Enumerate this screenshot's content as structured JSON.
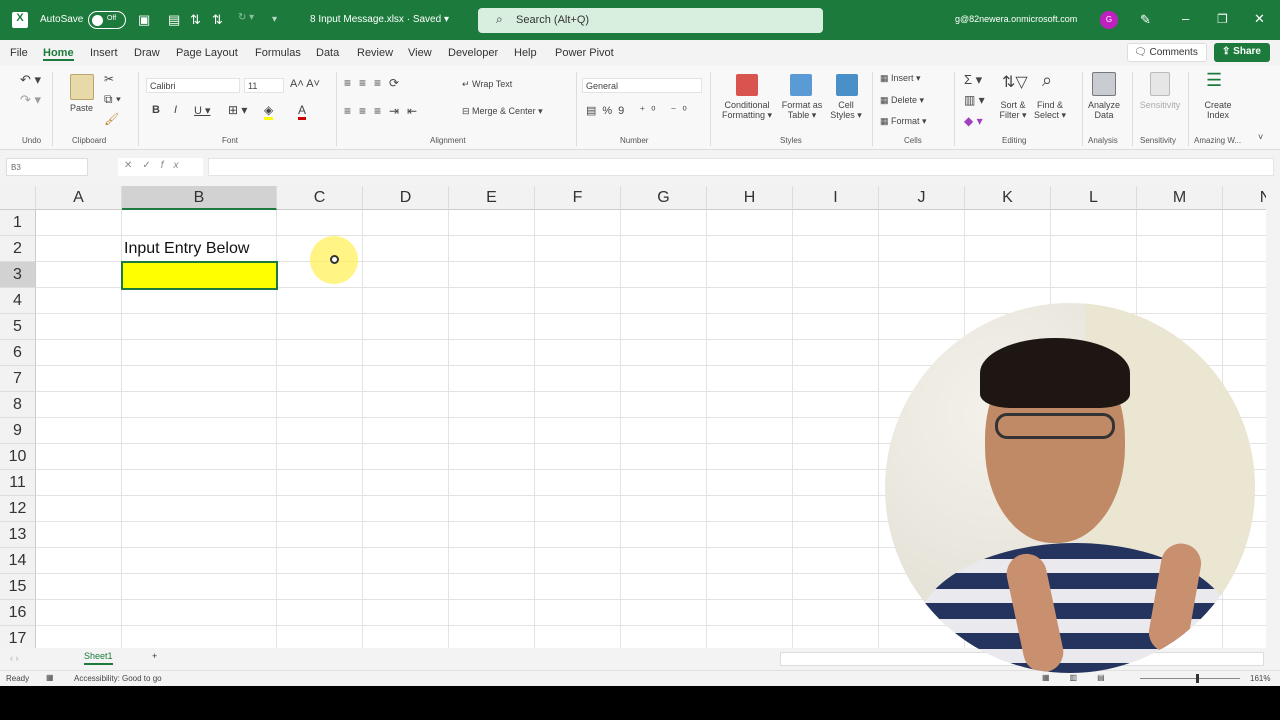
{
  "titlebar": {
    "autosave": "AutoSave",
    "toggle": "Off",
    "filename": "8 Input Message.xlsx · Saved ▾",
    "search": "Search (Alt+Q)",
    "account": "g@82newera.onmicrosoft.com",
    "avatar": "G"
  },
  "menu": [
    "File",
    "Home",
    "Insert",
    "Draw",
    "Page Layout",
    "Formulas",
    "Data",
    "Review",
    "View",
    "Developer",
    "Help",
    "Power Pivot"
  ],
  "comments": "Comments",
  "share": "Share",
  "ribbon": {
    "font_name": "Calibri",
    "font_size": "11",
    "wrap_text": "Wrap Text",
    "merge": "Merge & Center",
    "number_format": "General",
    "paste": "Paste",
    "cond_fmt": "Conditional Formatting ▾",
    "fmt_table": "Format as Table ▾",
    "cell_styles": "Cell Styles ▾",
    "insert": "Insert",
    "delete": "Delete",
    "format": "Format",
    "sort": "Sort & Filter ▾",
    "find": "Find & Select ▾",
    "analyze": "Analyze Data",
    "sensitivity": "Sensitivity",
    "create_index": "Create Index",
    "groups": [
      "Undo",
      "Clipboard",
      "Font",
      "Alignment",
      "Number",
      "Styles",
      "Cells",
      "Editing",
      "Analysis",
      "Sensitivity",
      "Amazing W..."
    ]
  },
  "namebox": "B3",
  "fx": "fx",
  "columns": [
    "A",
    "B",
    "C",
    "D",
    "E",
    "F",
    "G",
    "H",
    "I",
    "J",
    "K",
    "L",
    "M",
    "N"
  ],
  "rows": [
    "1",
    "2",
    "3",
    "4",
    "5",
    "6",
    "7",
    "8",
    "9",
    "10",
    "11",
    "12",
    "13",
    "14",
    "15",
    "16",
    "17"
  ],
  "cells": {
    "B2": "Input Entry Below"
  },
  "highlight_color": "#ffff00",
  "sheet_tab": "Sheet1",
  "add_sheet": "+",
  "status": {
    "ready": "Ready",
    "accessibility": "Accessibility: Good to go",
    "zoom": "161%"
  }
}
